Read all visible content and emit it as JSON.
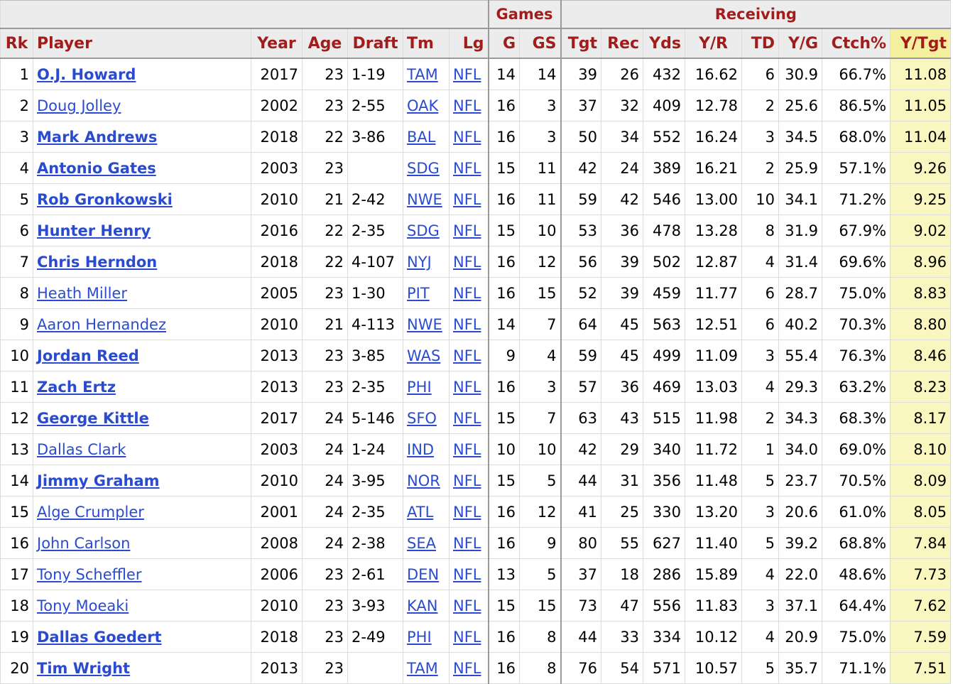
{
  "groups": {
    "games": "Games",
    "receiving": "Receiving"
  },
  "columns": {
    "rk": "Rk",
    "player": "Player",
    "year": "Year",
    "age": "Age",
    "draft": "Draft",
    "tm": "Tm",
    "lg": "Lg",
    "g": "G",
    "gs": "GS",
    "tgt": "Tgt",
    "rec": "Rec",
    "yds": "Yds",
    "yr": "Y/R",
    "td": "TD",
    "yg": "Y/G",
    "ctch": "Ctch%",
    "ytgt": "Y/Tgt"
  },
  "colors": {
    "header_text": "#a31c1c",
    "link": "#2a4bcf",
    "sort_highlight": "#f9f6bf"
  },
  "rows": [
    {
      "rk": "1",
      "player": "O.J. Howard",
      "bold": true,
      "year": "2017",
      "age": "23",
      "draft": "1-19",
      "tm": "TAM",
      "lg": "NFL",
      "g": "14",
      "gs": "14",
      "tgt": "39",
      "rec": "26",
      "yds": "432",
      "yr": "16.62",
      "td": "6",
      "yg": "30.9",
      "ctch": "66.7%",
      "ytgt": "11.08"
    },
    {
      "rk": "2",
      "player": "Doug Jolley",
      "bold": false,
      "year": "2002",
      "age": "23",
      "draft": "2-55",
      "tm": "OAK",
      "lg": "NFL",
      "g": "16",
      "gs": "3",
      "tgt": "37",
      "rec": "32",
      "yds": "409",
      "yr": "12.78",
      "td": "2",
      "yg": "25.6",
      "ctch": "86.5%",
      "ytgt": "11.05"
    },
    {
      "rk": "3",
      "player": "Mark Andrews",
      "bold": true,
      "year": "2018",
      "age": "22",
      "draft": "3-86",
      "tm": "BAL",
      "lg": "NFL",
      "g": "16",
      "gs": "3",
      "tgt": "50",
      "rec": "34",
      "yds": "552",
      "yr": "16.24",
      "td": "3",
      "yg": "34.5",
      "ctch": "68.0%",
      "ytgt": "11.04"
    },
    {
      "rk": "4",
      "player": "Antonio Gates",
      "bold": true,
      "year": "2003",
      "age": "23",
      "draft": "",
      "tm": "SDG",
      "lg": "NFL",
      "g": "15",
      "gs": "11",
      "tgt": "42",
      "rec": "24",
      "yds": "389",
      "yr": "16.21",
      "td": "2",
      "yg": "25.9",
      "ctch": "57.1%",
      "ytgt": "9.26"
    },
    {
      "rk": "5",
      "player": "Rob Gronkowski",
      "bold": true,
      "year": "2010",
      "age": "21",
      "draft": "2-42",
      "tm": "NWE",
      "lg": "NFL",
      "g": "16",
      "gs": "11",
      "tgt": "59",
      "rec": "42",
      "yds": "546",
      "yr": "13.00",
      "td": "10",
      "yg": "34.1",
      "ctch": "71.2%",
      "ytgt": "9.25"
    },
    {
      "rk": "6",
      "player": "Hunter Henry",
      "bold": true,
      "year": "2016",
      "age": "22",
      "draft": "2-35",
      "tm": "SDG",
      "lg": "NFL",
      "g": "15",
      "gs": "10",
      "tgt": "53",
      "rec": "36",
      "yds": "478",
      "yr": "13.28",
      "td": "8",
      "yg": "31.9",
      "ctch": "67.9%",
      "ytgt": "9.02"
    },
    {
      "rk": "7",
      "player": "Chris Herndon",
      "bold": true,
      "year": "2018",
      "age": "22",
      "draft": "4-107",
      "tm": "NYJ",
      "lg": "NFL",
      "g": "16",
      "gs": "12",
      "tgt": "56",
      "rec": "39",
      "yds": "502",
      "yr": "12.87",
      "td": "4",
      "yg": "31.4",
      "ctch": "69.6%",
      "ytgt": "8.96"
    },
    {
      "rk": "8",
      "player": "Heath Miller",
      "bold": false,
      "year": "2005",
      "age": "23",
      "draft": "1-30",
      "tm": "PIT",
      "lg": "NFL",
      "g": "16",
      "gs": "15",
      "tgt": "52",
      "rec": "39",
      "yds": "459",
      "yr": "11.77",
      "td": "6",
      "yg": "28.7",
      "ctch": "75.0%",
      "ytgt": "8.83"
    },
    {
      "rk": "9",
      "player": "Aaron Hernandez",
      "bold": false,
      "year": "2010",
      "age": "21",
      "draft": "4-113",
      "tm": "NWE",
      "lg": "NFL",
      "g": "14",
      "gs": "7",
      "tgt": "64",
      "rec": "45",
      "yds": "563",
      "yr": "12.51",
      "td": "6",
      "yg": "40.2",
      "ctch": "70.3%",
      "ytgt": "8.80"
    },
    {
      "rk": "10",
      "player": "Jordan Reed",
      "bold": true,
      "year": "2013",
      "age": "23",
      "draft": "3-85",
      "tm": "WAS",
      "lg": "NFL",
      "g": "9",
      "gs": "4",
      "tgt": "59",
      "rec": "45",
      "yds": "499",
      "yr": "11.09",
      "td": "3",
      "yg": "55.4",
      "ctch": "76.3%",
      "ytgt": "8.46"
    },
    {
      "rk": "11",
      "player": "Zach Ertz",
      "bold": true,
      "year": "2013",
      "age": "23",
      "draft": "2-35",
      "tm": "PHI",
      "lg": "NFL",
      "g": "16",
      "gs": "3",
      "tgt": "57",
      "rec": "36",
      "yds": "469",
      "yr": "13.03",
      "td": "4",
      "yg": "29.3",
      "ctch": "63.2%",
      "ytgt": "8.23"
    },
    {
      "rk": "12",
      "player": "George Kittle",
      "bold": true,
      "year": "2017",
      "age": "24",
      "draft": "5-146",
      "tm": "SFO",
      "lg": "NFL",
      "g": "15",
      "gs": "7",
      "tgt": "63",
      "rec": "43",
      "yds": "515",
      "yr": "11.98",
      "td": "2",
      "yg": "34.3",
      "ctch": "68.3%",
      "ytgt": "8.17"
    },
    {
      "rk": "13",
      "player": "Dallas Clark",
      "bold": false,
      "year": "2003",
      "age": "24",
      "draft": "1-24",
      "tm": "IND",
      "lg": "NFL",
      "g": "10",
      "gs": "10",
      "tgt": "42",
      "rec": "29",
      "yds": "340",
      "yr": "11.72",
      "td": "1",
      "yg": "34.0",
      "ctch": "69.0%",
      "ytgt": "8.10"
    },
    {
      "rk": "14",
      "player": "Jimmy Graham",
      "bold": true,
      "year": "2010",
      "age": "24",
      "draft": "3-95",
      "tm": "NOR",
      "lg": "NFL",
      "g": "15",
      "gs": "5",
      "tgt": "44",
      "rec": "31",
      "yds": "356",
      "yr": "11.48",
      "td": "5",
      "yg": "23.7",
      "ctch": "70.5%",
      "ytgt": "8.09"
    },
    {
      "rk": "15",
      "player": "Alge Crumpler",
      "bold": false,
      "year": "2001",
      "age": "24",
      "draft": "2-35",
      "tm": "ATL",
      "lg": "NFL",
      "g": "16",
      "gs": "12",
      "tgt": "41",
      "rec": "25",
      "yds": "330",
      "yr": "13.20",
      "td": "3",
      "yg": "20.6",
      "ctch": "61.0%",
      "ytgt": "8.05"
    },
    {
      "rk": "16",
      "player": "John Carlson",
      "bold": false,
      "year": "2008",
      "age": "24",
      "draft": "2-38",
      "tm": "SEA",
      "lg": "NFL",
      "g": "16",
      "gs": "9",
      "tgt": "80",
      "rec": "55",
      "yds": "627",
      "yr": "11.40",
      "td": "5",
      "yg": "39.2",
      "ctch": "68.8%",
      "ytgt": "7.84"
    },
    {
      "rk": "17",
      "player": "Tony Scheffler",
      "bold": false,
      "year": "2006",
      "age": "23",
      "draft": "2-61",
      "tm": "DEN",
      "lg": "NFL",
      "g": "13",
      "gs": "5",
      "tgt": "37",
      "rec": "18",
      "yds": "286",
      "yr": "15.89",
      "td": "4",
      "yg": "22.0",
      "ctch": "48.6%",
      "ytgt": "7.73"
    },
    {
      "rk": "18",
      "player": "Tony Moeaki",
      "bold": false,
      "year": "2010",
      "age": "23",
      "draft": "3-93",
      "tm": "KAN",
      "lg": "NFL",
      "g": "15",
      "gs": "15",
      "tgt": "73",
      "rec": "47",
      "yds": "556",
      "yr": "11.83",
      "td": "3",
      "yg": "37.1",
      "ctch": "64.4%",
      "ytgt": "7.62"
    },
    {
      "rk": "19",
      "player": "Dallas Goedert",
      "bold": true,
      "year": "2018",
      "age": "23",
      "draft": "2-49",
      "tm": "PHI",
      "lg": "NFL",
      "g": "16",
      "gs": "8",
      "tgt": "44",
      "rec": "33",
      "yds": "334",
      "yr": "10.12",
      "td": "4",
      "yg": "20.9",
      "ctch": "75.0%",
      "ytgt": "7.59"
    },
    {
      "rk": "20",
      "player": "Tim Wright",
      "bold": true,
      "year": "2013",
      "age": "23",
      "draft": "",
      "tm": "TAM",
      "lg": "NFL",
      "g": "16",
      "gs": "8",
      "tgt": "76",
      "rec": "54",
      "yds": "571",
      "yr": "10.57",
      "td": "5",
      "yg": "35.7",
      "ctch": "71.1%",
      "ytgt": "7.51"
    }
  ]
}
